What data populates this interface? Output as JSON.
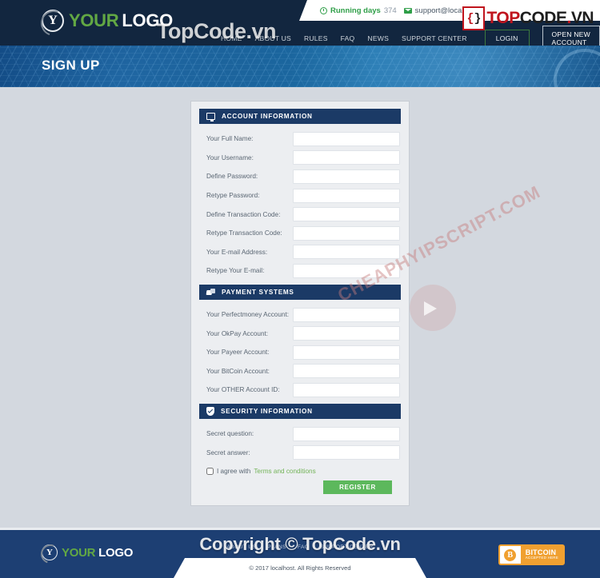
{
  "header": {
    "topbar": {
      "running_label": "Running days",
      "running_days": "374",
      "support_email": "support@localhost"
    },
    "logo": {
      "mark": "Y",
      "part1": "YOUR",
      "part2": "LOGO"
    },
    "nav": [
      {
        "label": "HOME"
      },
      {
        "label": "ABOUT US"
      },
      {
        "label": "RULES"
      },
      {
        "label": "FAQ"
      },
      {
        "label": "NEWS"
      },
      {
        "label": "SUPPORT CENTER"
      }
    ],
    "login_label": "LOGIN",
    "open_account_label": "OPEN NEW ACCOUNT",
    "topcode": {
      "brace_r": "{",
      "brace_d": "}",
      "top": "TOP",
      "code": "CODE",
      "dot": ".",
      "vn": "VN"
    }
  },
  "banner": {
    "title": "SIGN UP"
  },
  "form": {
    "sections": [
      {
        "title": "ACCOUNT INFORMATION",
        "icon": "monitor-icon",
        "fields": [
          {
            "label": "Your Full Name:",
            "value": "",
            "placeholder": ""
          },
          {
            "label": "Your Username:",
            "value": "",
            "placeholder": ""
          },
          {
            "label": "Define Password:",
            "value": "",
            "placeholder": ""
          },
          {
            "label": "Retype Password:",
            "value": "",
            "placeholder": ""
          },
          {
            "label": "Define Transaction Code:",
            "value": "",
            "placeholder": ""
          },
          {
            "label": "Retype Transaction Code:",
            "value": "",
            "placeholder": ""
          },
          {
            "label": "Your E-mail Address:",
            "value": "",
            "placeholder": ""
          },
          {
            "label": "Retype Your E-mail:",
            "value": "",
            "placeholder": ""
          }
        ]
      },
      {
        "title": "PAYMENT SYSTEMS",
        "icon": "cards-icon",
        "fields": [
          {
            "label": "Your Perfectmoney Account:",
            "value": "",
            "placeholder": ""
          },
          {
            "label": "Your OkPay Account:",
            "value": "",
            "placeholder": ""
          },
          {
            "label": "Your Payeer Account:",
            "value": "",
            "placeholder": ""
          },
          {
            "label": "Your BitCoin Account:",
            "value": "",
            "placeholder": ""
          },
          {
            "label": "Your OTHER Account ID:",
            "value": "",
            "placeholder": ""
          }
        ]
      },
      {
        "title": "SECURITY INFORMATION",
        "icon": "shield-icon",
        "fields": [
          {
            "label": "Secret question:",
            "value": "",
            "placeholder": ""
          },
          {
            "label": "Secret answer:",
            "value": "",
            "placeholder": ""
          }
        ]
      }
    ],
    "agree_text": "I agree with",
    "terms_link": "Terms and conditions",
    "register_label": "REGISTER"
  },
  "footer": {
    "logo": {
      "mark": "Y",
      "part1": "YOUR",
      "part2": "LOGO"
    },
    "nav": [
      {
        "label": "ABOUT US"
      },
      {
        "label": "PLANS"
      },
      {
        "label": "FAQ"
      },
      {
        "label": "SUPPORT CENTER"
      }
    ],
    "copyright": "© 2017 localhost. All Rights Reserved",
    "bitcoin": {
      "line1": "BITCOIN",
      "line2": "ACCEPTED HERE",
      "symbol": "B"
    }
  },
  "watermarks": {
    "header_text": "TopCode.vn",
    "copyright_text": "Copyright © TopCode.vn",
    "diagonal_text": "CHEAPHYIPSCRIPT.COM"
  },
  "colors": {
    "header_bg": "#12263f",
    "banner_blue": "#15598f",
    "section_head": "#1b3a66",
    "accent_green": "#5cb85c",
    "logo_green": "#62a844",
    "footer_bg": "#1d3f73",
    "page_bg": "#d3d8df",
    "topcode_red": "#c0141d",
    "bitcoin_orange": "#f0a030"
  }
}
